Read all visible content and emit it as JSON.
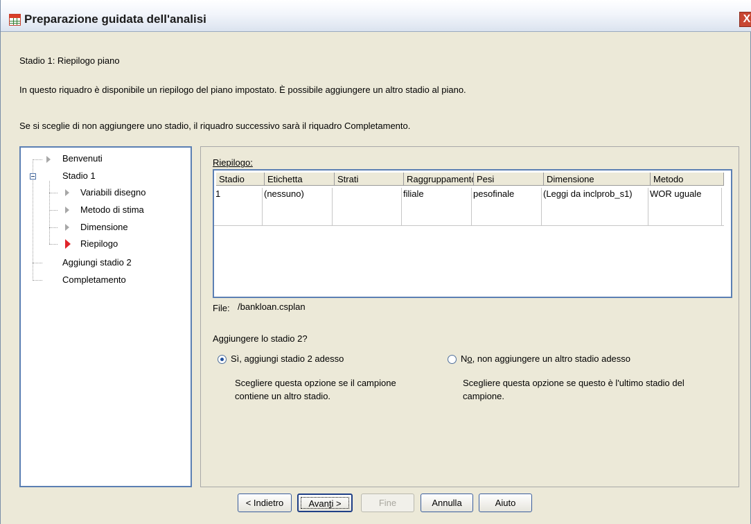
{
  "window": {
    "title": "Preparazione guidata dell'analisi",
    "close_glyph": "X",
    "icon": "table-icon",
    "title_gradient": [
      "#ffffff",
      "#dbe3ef"
    ]
  },
  "header": {
    "stage_title": "Stadio 1: Riepilogo piano",
    "description": "In questo riquadro è disponibile un riepilogo del piano impostato. È possibile aggiungere un altro stadio al piano.",
    "note": "Se si sceglie di non aggiungere uno stadio, il riquadro successivo sarà il riquadro Completamento."
  },
  "tree": {
    "items": [
      {
        "label": "Benvenuti"
      },
      {
        "label": "Stadio 1"
      },
      {
        "label": "Variabili disegno"
      },
      {
        "label": "Metodo di stima"
      },
      {
        "label": "Dimensione"
      },
      {
        "label": "Riepilogo",
        "active": true
      },
      {
        "label": "Aggiungi stadio 2"
      },
      {
        "label": "Completamento"
      }
    ]
  },
  "summary": {
    "label": "Riepilogo:",
    "columns": [
      "Stadio",
      "Etichetta",
      "Strati",
      "Raggruppamento",
      "Pesi",
      "Dimensione",
      "Metodo"
    ],
    "rows": [
      [
        "1",
        "(nessuno)",
        "",
        "filiale",
        "pesofinale",
        "(Leggi da inclprob_s1)",
        "WOR uguale"
      ]
    ]
  },
  "file": {
    "label": "File:",
    "value": "/bankloan.csplan"
  },
  "question": "Aggiungere lo stadio 2?",
  "options": {
    "yes": {
      "label": "Sì, aggiungi stadio 2 adesso",
      "help_line1": "Scegliere questa opzione se il campione",
      "help_line2": "contiene un altro stadio.",
      "checked": true
    },
    "no": {
      "label_pre": "N",
      "label_u": "o",
      "label_post": ", non aggiungere un altro stadio adesso",
      "help_line1": "Scegliere questa opzione se questo è l'ultimo stadio del",
      "help_line2": "campione.",
      "checked": false
    }
  },
  "buttons": {
    "back": "< Indietro",
    "next_pre": "Avan",
    "next_u": "t",
    "next_post": "i >",
    "finish": "Fine",
    "cancel": "Annulla",
    "help": "Aiuto"
  },
  "colors": {
    "dialog_bg": "#ece9d8",
    "accent_border": "#5b7fb3",
    "active_marker": "#e0242a"
  }
}
